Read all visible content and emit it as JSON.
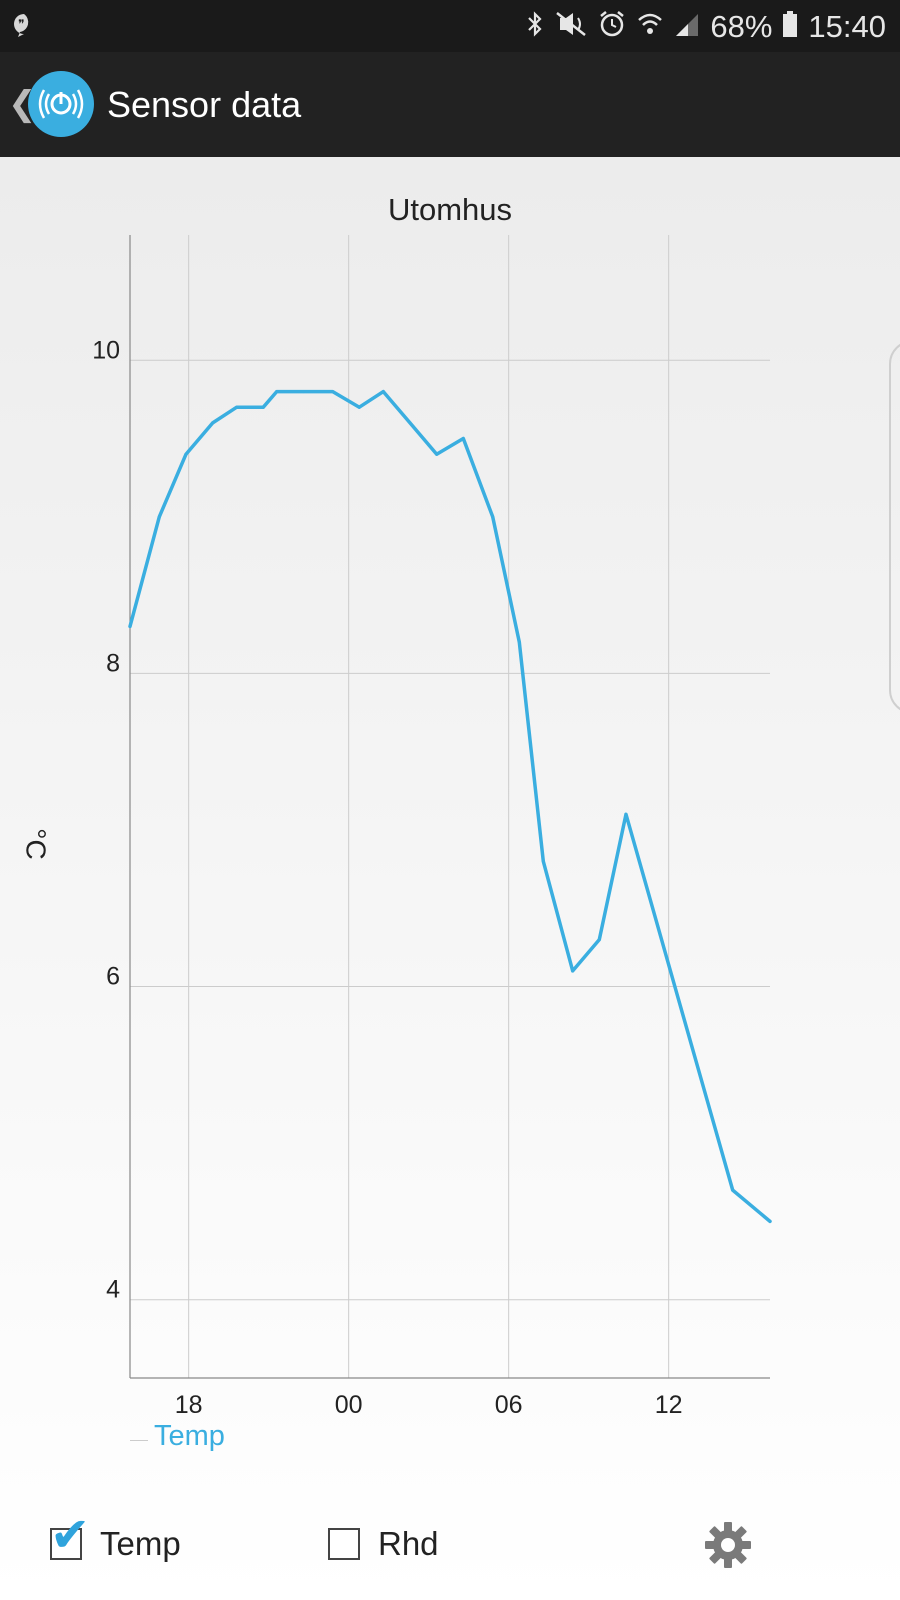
{
  "status_bar": {
    "battery": "68%",
    "time": "15:40",
    "left_icon": "chat-bubble-icon",
    "right_icons": [
      "bluetooth-icon",
      "mute-icon",
      "alarm-icon",
      "wifi-icon",
      "signal-icon",
      "battery-icon"
    ]
  },
  "action_bar": {
    "title": "Sensor data",
    "back_icon": "chevron-left-icon",
    "app_icon": "power-signal-icon"
  },
  "controls": {
    "temp_label": "Temp",
    "temp_checked": true,
    "rhd_label": "Rhd",
    "rhd_checked": false,
    "settings_icon": "gear-icon"
  },
  "colors": {
    "series": "#3aaee0",
    "grid": "#cccccc",
    "axis_text": "#222222"
  },
  "chart_data": {
    "type": "line",
    "title": "Utomhus",
    "ylabel": "°C",
    "xlabel": "",
    "x_ticks": [
      "18",
      "00",
      "06",
      "12"
    ],
    "x_tick_hours": [
      18,
      24,
      30,
      36
    ],
    "x_range_hours": [
      15.8,
      39.8
    ],
    "ylim": [
      3.5,
      10.8
    ],
    "y_ticks": [
      4,
      6,
      8,
      10
    ],
    "grid": true,
    "legend": "bottom-left",
    "series": [
      {
        "name": "Temp",
        "x_hours": [
          15.8,
          16.9,
          17.9,
          18.9,
          19.8,
          20.8,
          21.3,
          22.3,
          23.4,
          24.4,
          25.3,
          26.3,
          27.3,
          28.3,
          29.4,
          30.4,
          31.3,
          32.4,
          33.4,
          34.4,
          35.4,
          36.4,
          37.4,
          38.4,
          39.8
        ],
        "values": [
          8.3,
          9.0,
          9.4,
          9.6,
          9.7,
          9.7,
          9.8,
          9.8,
          9.8,
          9.7,
          9.8,
          9.6,
          9.4,
          9.5,
          9.0,
          8.2,
          6.8,
          6.1,
          6.3,
          7.1,
          6.5,
          5.9,
          5.3,
          4.7,
          4.5
        ]
      }
    ]
  }
}
